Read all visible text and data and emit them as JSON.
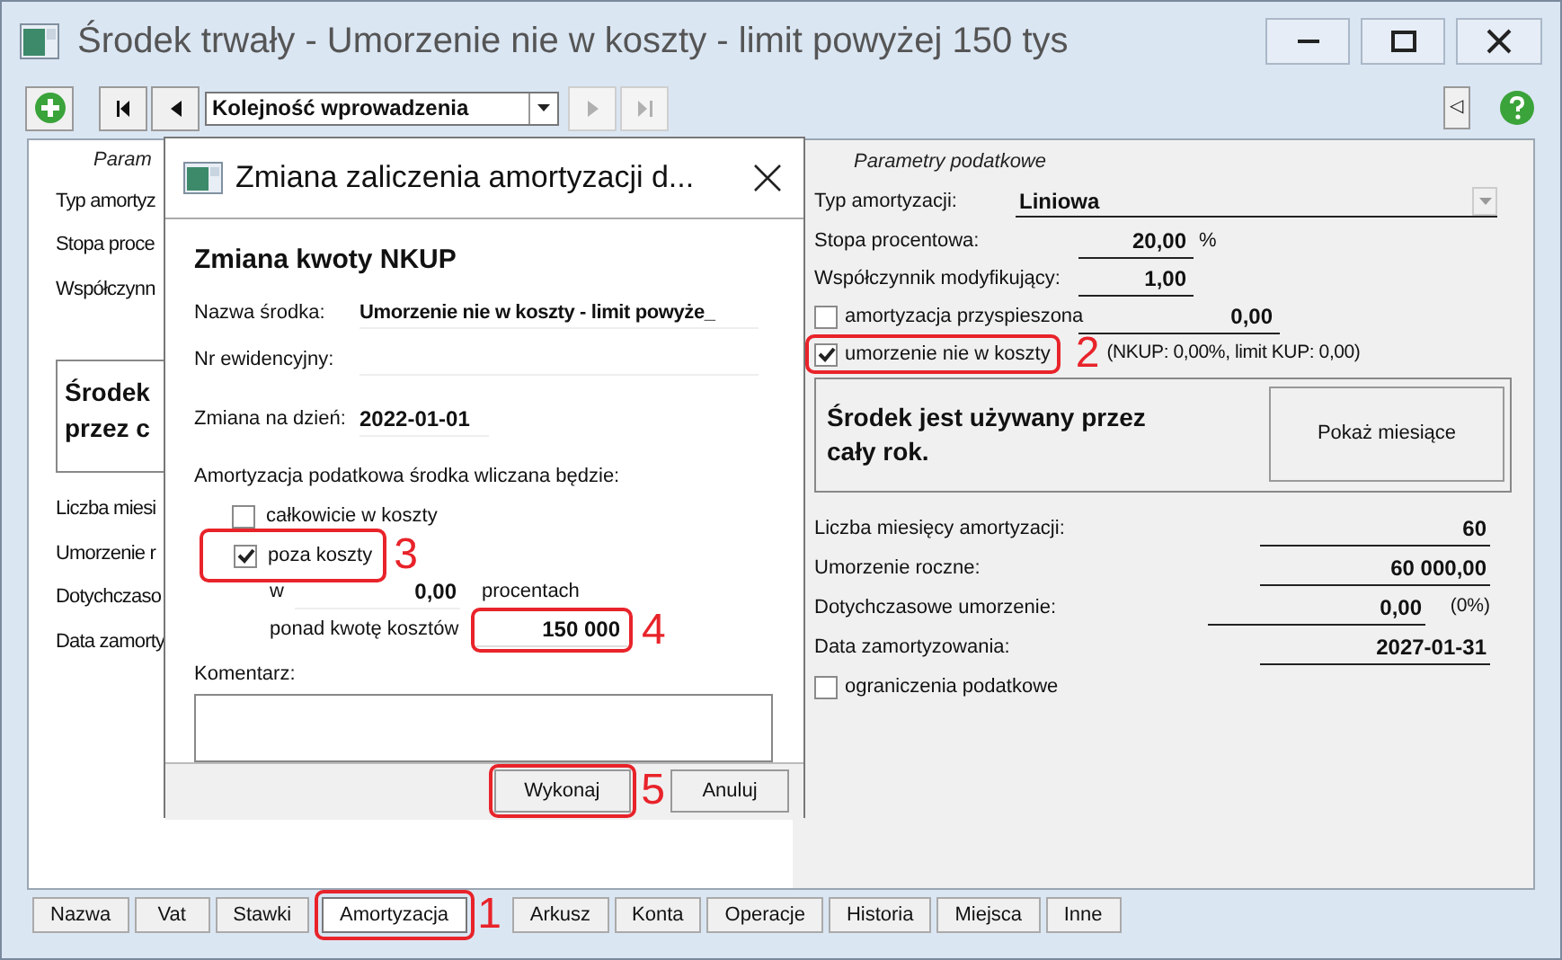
{
  "window": {
    "title": "Środek trwały - Umorzenie nie w koszty - limit powyżej 150 tys"
  },
  "toolbar": {
    "nav_buttons": [
      {
        "kind": "first",
        "disabled": false
      },
      {
        "kind": "prev",
        "disabled": false
      },
      {
        "kind": "next",
        "disabled": true
      },
      {
        "kind": "last",
        "disabled": true
      }
    ],
    "sort": "Kolejność wprowadzenia",
    "collapse": "◁"
  },
  "left_panel": {
    "heading": "Param",
    "rows": [
      "Typ amortyz",
      "Stopa proce",
      "Współczynn"
    ],
    "notice": [
      "Środek",
      "przez c"
    ],
    "rows2": [
      "Liczba miesi",
      "Umorzenie r",
      "Dotychczaso",
      "Data zamorty"
    ]
  },
  "right_panel": {
    "heading": "Parametry podatkowe",
    "type": {
      "label": "Typ amortyzacji:",
      "value": "Liniowa"
    },
    "rate": {
      "label": "Stopa procentowa:",
      "value": "20,00",
      "unit": "%"
    },
    "factor": {
      "label": "Współczynnik modyfikujący:",
      "value": "1,00"
    },
    "accelerated": {
      "label": "amortyzacja przyspieszona",
      "checked": false,
      "value": "0,00"
    },
    "nkup": {
      "label": "umorzenie nie w koszty",
      "checked": true,
      "note": "(NKUP: 0,00%, limit KUP: 0,00)"
    },
    "notice": "Środek jest używany przez cały rok.",
    "months_button": "Pokaż miesiące",
    "stats": [
      {
        "label": "Liczba miesięcy amortyzacji:",
        "value": "60"
      },
      {
        "label": "Umorzenie roczne:",
        "value": "60 000,00"
      },
      {
        "label": "Dotychczasowe umorzenie:",
        "value": "0,00",
        "suffix": "(0%)"
      },
      {
        "label": "Data zamortyzowania:",
        "value": "2027-01-31"
      }
    ],
    "limits": {
      "label": "ograniczenia podatkowe",
      "checked": false
    }
  },
  "tabs": [
    {
      "label": "Nazwa",
      "selected": false
    },
    {
      "label": "Vat",
      "selected": false
    },
    {
      "label": "Stawki",
      "selected": false
    },
    {
      "label": "Amortyzacja",
      "selected": true
    },
    {
      "label": "Arkusz",
      "selected": false
    },
    {
      "label": "Konta",
      "selected": false
    },
    {
      "label": "Operacje",
      "selected": false
    },
    {
      "label": "Historia",
      "selected": false
    },
    {
      "label": "Miejsca",
      "selected": false
    },
    {
      "label": "Inne",
      "selected": false
    }
  ],
  "dialog": {
    "title": "Zmiana zaliczenia amortyzacji d...",
    "heading": "Zmiana kwoty NKUP",
    "name": {
      "label": "Nazwa środka:",
      "value": "Umorzenie nie w koszty - limit powyże_"
    },
    "number": {
      "label": "Nr ewidencyjny:"
    },
    "date": {
      "label": "Zmiana na dzień:",
      "value": "2022-01-01"
    },
    "question": "Amortyzacja podatkowa środka wliczana będzie:",
    "options": [
      {
        "label": "całkowicie w koszty",
        "checked": false
      },
      {
        "label": "poza koszty",
        "checked": true
      }
    ],
    "percent": {
      "label": "w",
      "value": "0,00",
      "unit": "procentach"
    },
    "threshold": {
      "label": "ponad kwotę kosztów",
      "value": "150 000"
    },
    "comment": {
      "label": "Komentarz:"
    },
    "buttons": [
      "Wykonaj",
      "Anuluj"
    ]
  },
  "annotations": [
    {
      "label": "1"
    },
    {
      "label": "2"
    },
    {
      "label": "3"
    },
    {
      "label": "4"
    },
    {
      "label": "5"
    }
  ]
}
